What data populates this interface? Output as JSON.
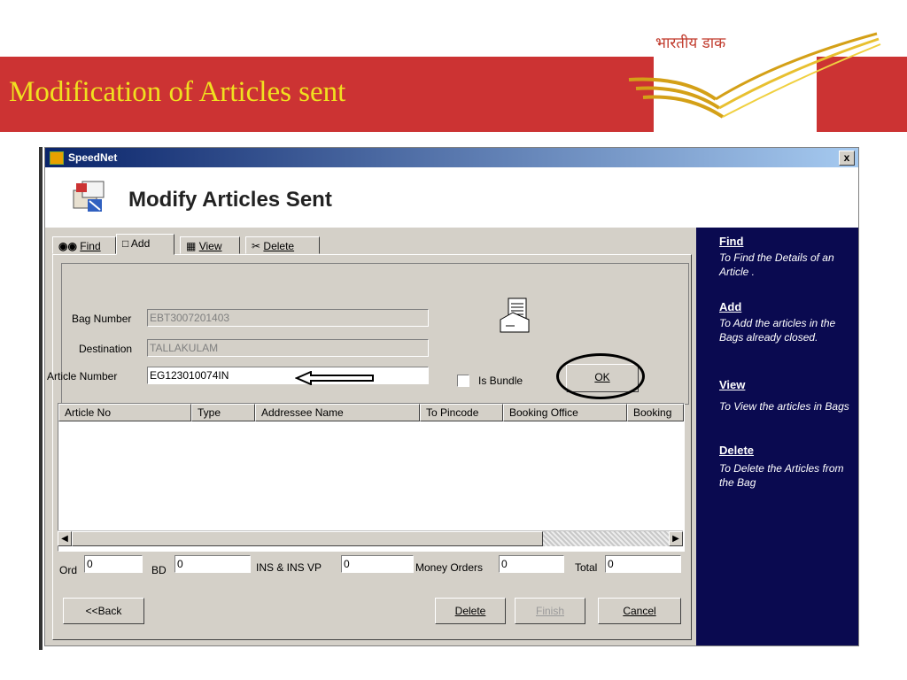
{
  "slide": {
    "title": "Modification of Articles sent",
    "logo_text": "भारतीय डाक"
  },
  "window": {
    "app_title": "SpeedNet",
    "close_label": "x",
    "form_title": "Modify Articles Sent"
  },
  "tabs": [
    {
      "label": "Find",
      "icon": "binoculars-icon"
    },
    {
      "label": "Add",
      "icon": "document-icon"
    },
    {
      "label": "View",
      "icon": "view-icon"
    },
    {
      "label": "Delete",
      "icon": "scissors-icon"
    }
  ],
  "form": {
    "bag_number_label": "Bag Number",
    "bag_number_value": "EBT3007201403",
    "destination_label": "Destination",
    "destination_value": "TALLAKULAM",
    "article_number_label": "Article Number",
    "article_number_value": "EG123010074IN",
    "is_bundle_label": "Is Bundle",
    "ok_label": "OK"
  },
  "table": {
    "columns": [
      "Article No",
      "Type",
      "Addressee Name",
      "To Pincode",
      "Booking Office",
      "Booking"
    ],
    "rows": []
  },
  "counts": {
    "ord_label": "Ord",
    "ord_value": "0",
    "bd_label": "BD",
    "bd_value": "0",
    "ins_label": "INS & INS VP",
    "ins_value": "0",
    "mo_label": "Money Orders",
    "mo_value": "0",
    "total_label": "Total",
    "total_value": "0"
  },
  "buttons": {
    "back": "<<Back",
    "delete": "Delete",
    "finish": "Finish",
    "cancel": "Cancel"
  },
  "help": [
    {
      "heading": "Find",
      "text": "To Find the Details of an Article ."
    },
    {
      "heading": "Add",
      "text": "To Add the articles in the Bags already closed."
    },
    {
      "heading": "View",
      "text": "To View the articles in Bags"
    },
    {
      "heading": "Delete",
      "text": "To Delete the Articles from the Bag"
    }
  ],
  "colors": {
    "band": "#cc3333",
    "title": "#f0e020",
    "help_bg": "#0a0a50"
  }
}
